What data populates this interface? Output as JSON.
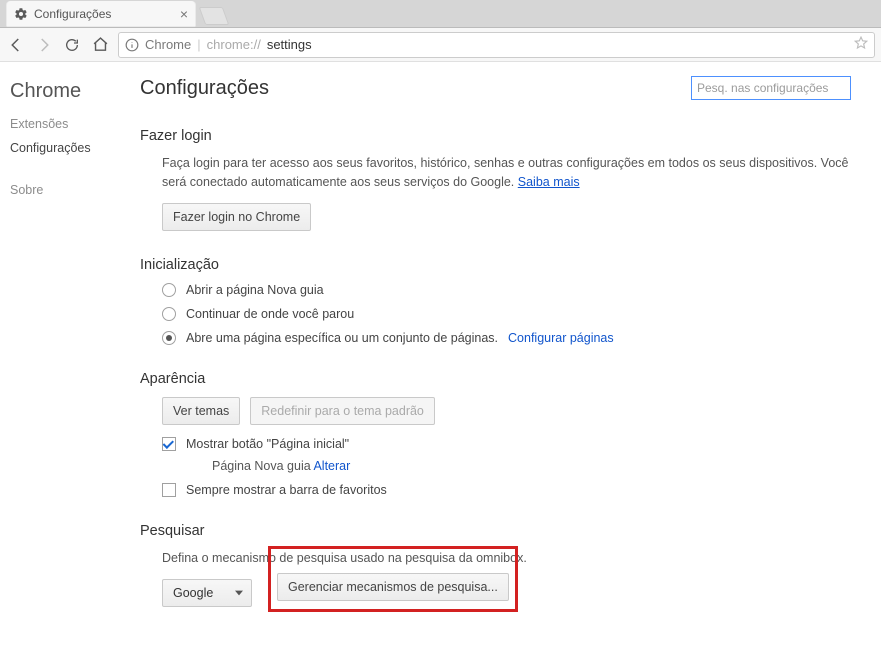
{
  "tab": {
    "title": "Configurações"
  },
  "omnibox": {
    "label": "Chrome",
    "url_prefix": "chrome://",
    "url_main": "settings"
  },
  "sidebar": {
    "title": "Chrome",
    "links": {
      "extensions": "Extensões",
      "settings": "Configurações",
      "about": "Sobre"
    }
  },
  "header": {
    "title": "Configurações",
    "search_placeholder": "Pesq. nas configurações"
  },
  "signin": {
    "title": "Fazer login",
    "desc": "Faça login para ter acesso aos seus favoritos, histórico, senhas e outras configurações em todos os seus dispositivos. Você será conectado automaticamente aos seus serviços do Google. ",
    "learn_more": "Saiba mais",
    "button": "Fazer login no Chrome"
  },
  "startup": {
    "title": "Inicialização",
    "options": [
      "Abrir a página Nova guia",
      "Continuar de onde você parou",
      "Abre uma página específica ou um conjunto de páginas. "
    ],
    "set_pages": "Configurar páginas"
  },
  "appearance": {
    "title": "Aparência",
    "themes_button": "Ver temas",
    "reset_button": "Redefinir para o tema padrão",
    "show_home": "Mostrar botão \"Página inicial\"",
    "home_sub": "Página Nova guia ",
    "home_change": "Alterar",
    "show_bookmarks": "Sempre mostrar a barra de favoritos"
  },
  "search": {
    "title": "Pesquisar",
    "desc": "Defina o mecanismo de pesquisa usado na pesquisa da omnibox.",
    "engine": "Google",
    "manage_button": "Gerenciar mecanismos de pesquisa..."
  }
}
